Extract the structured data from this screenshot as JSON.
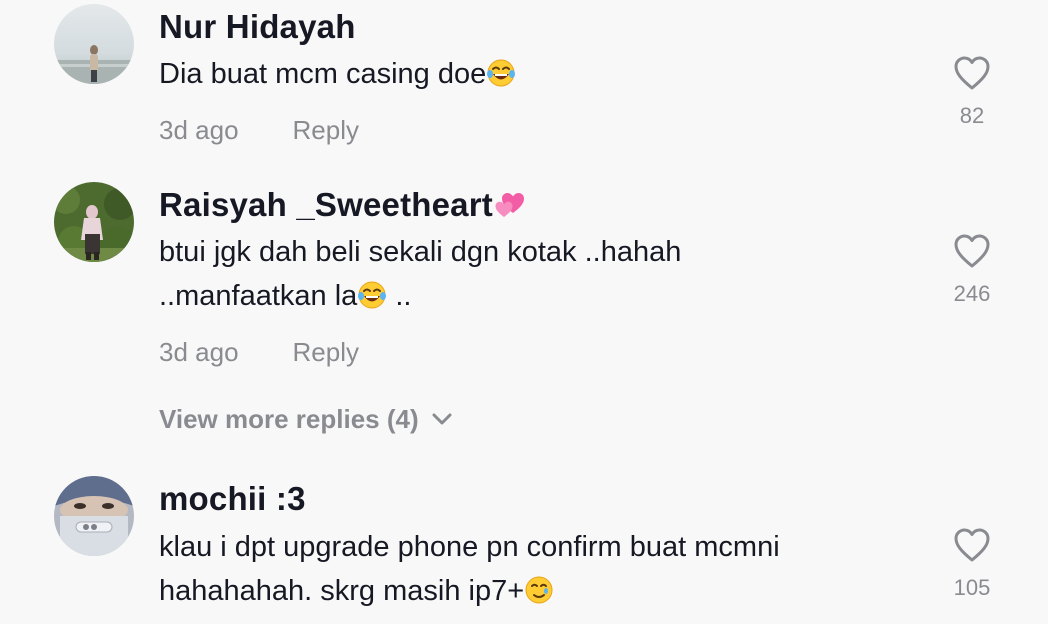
{
  "comments": [
    {
      "username": "Nur Hidayah",
      "text": "Dia buat mcm casing doe",
      "time": "3d ago",
      "reply_label": "Reply",
      "likes": "82"
    },
    {
      "username": "Raisyah _Sweetheart",
      "text_line1": "btui jgk dah beli sekali dgn kotak ..hahah",
      "text_line2_a": "..manfaatkan la",
      "text_line2_b": " ..",
      "time": "3d ago",
      "reply_label": "Reply",
      "likes": "246"
    },
    {
      "username": "mochii :3",
      "text_line1": "klau i dpt upgrade phone pn confirm buat mcmni",
      "text_line2": "hahahahah. skrg masih ip7+",
      "likes": "105"
    }
  ],
  "view_more_replies": "View more replies (4)",
  "icons": {
    "like": "heart-outline-icon",
    "expand": "chevron-down-icon",
    "emoji_laugh": "tears-of-joy-emoji",
    "emoji_hearts": "two-hearts-emoji",
    "emoji_sad": "smiling-with-tear-emoji"
  },
  "colors": {
    "background": "#f8f8f8",
    "primary_text": "#161823",
    "secondary_text": "#8a8b91"
  }
}
